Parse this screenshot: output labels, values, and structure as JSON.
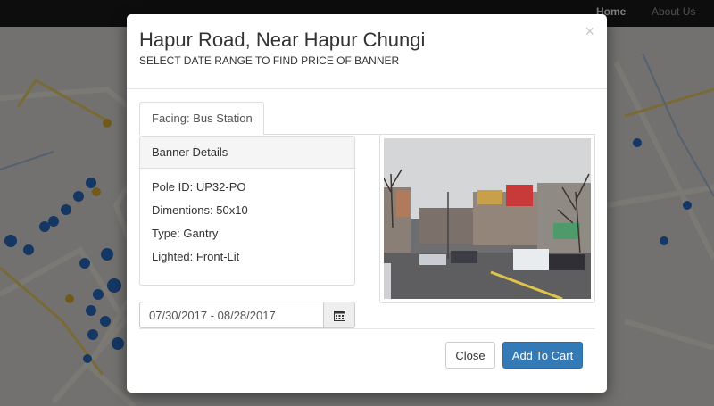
{
  "navbar": {
    "home_label": "Home",
    "about_label": "About Us"
  },
  "modal": {
    "title": "Hapur Road, Near Hapur Chungi",
    "subtitle": "SELECT DATE RANGE TO FIND PRICE OF BANNER",
    "close_glyph": "×",
    "tab_label": "Facing: Bus Station",
    "panel_heading": "Banner Details",
    "details": [
      "Pole ID: UP32-PO",
      "Dimentions: 50x10",
      "Type: Gantry",
      "Lighted: Front-Lit"
    ],
    "date_range": "07/30/2017 - 08/28/2017",
    "close_button": "Close",
    "cart_button": "Add To Cart"
  },
  "colors": {
    "primary": "#337ab7",
    "navbar": "#1b1b1b",
    "map_pin": "#2a6fc9"
  },
  "icons": [
    "close-icon",
    "calendar-icon",
    "map-pin-icon"
  ]
}
